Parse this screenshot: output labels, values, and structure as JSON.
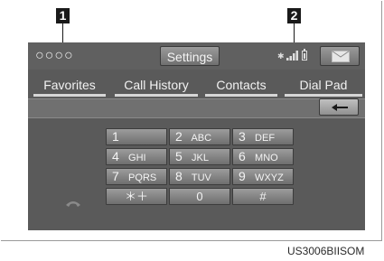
{
  "callouts": [
    "1",
    "2"
  ],
  "top_bar": {
    "carrier": "○○○○",
    "settings_label": "Settings"
  },
  "tabs": [
    "Favorites",
    "Call History",
    "Contacts",
    "Dial Pad"
  ],
  "keypad": [
    {
      "digit": "1",
      "letters": ""
    },
    {
      "digit": "2",
      "letters": "ABC"
    },
    {
      "digit": "3",
      "letters": "DEF"
    },
    {
      "digit": "4",
      "letters": "GHI"
    },
    {
      "digit": "5",
      "letters": "JKL"
    },
    {
      "digit": "6",
      "letters": "MNO"
    },
    {
      "digit": "7",
      "letters": "PQRS"
    },
    {
      "digit": "8",
      "letters": "TUV"
    },
    {
      "digit": "9",
      "letters": "WXYZ"
    },
    {
      "digit": "＊＋",
      "letters": ""
    },
    {
      "digit": "0",
      "letters": ""
    },
    {
      "digit": "#",
      "letters": ""
    }
  ],
  "icons": {
    "bluetooth": "bluetooth-icon",
    "signal": "signal-strength-icon",
    "battery": "battery-icon",
    "mail": "envelope-icon",
    "backspace": "left-arrow-icon",
    "call": "handset-icon"
  },
  "caption": "US3006BIISOM"
}
